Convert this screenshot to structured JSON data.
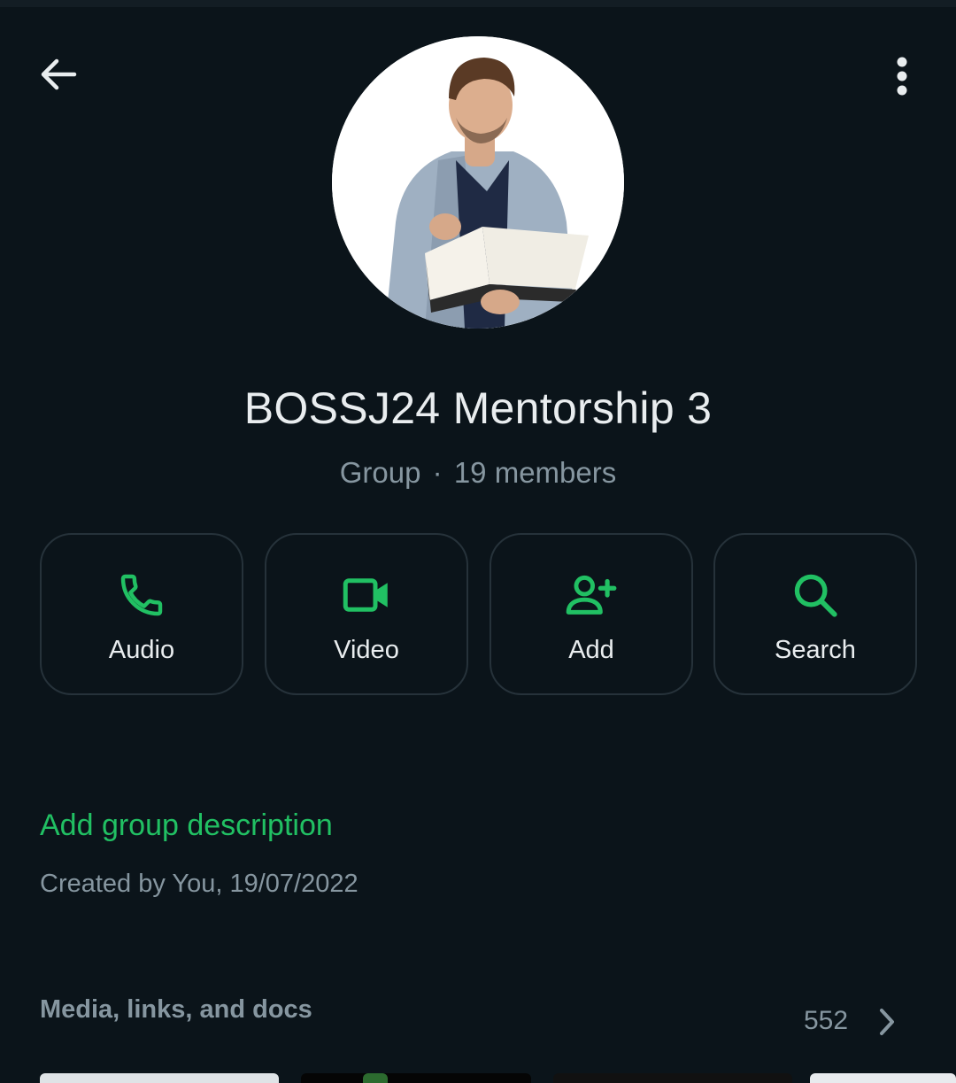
{
  "header": {
    "back_icon": "arrow-left-icon",
    "menu_icon": "more-vertical-icon"
  },
  "group": {
    "name": "BOSSJ24 Mentorship 3",
    "type": "Group",
    "separator": "·",
    "members": "19 members"
  },
  "actions": [
    {
      "label": "Audio",
      "icon": "phone-icon"
    },
    {
      "label": "Video",
      "icon": "video-camera-icon"
    },
    {
      "label": "Add",
      "icon": "add-person-icon"
    },
    {
      "label": "Search",
      "icon": "search-icon"
    }
  ],
  "description": {
    "add_label": "Add group description",
    "created": "Created by You, 19/07/2022"
  },
  "media": {
    "label": "Media, links, and docs",
    "count": "552",
    "icon": "chevron-right-icon"
  },
  "colors": {
    "background": "#0b141a",
    "accent": "#21c063",
    "primary_text": "#e9edef",
    "secondary_text": "#8696a0",
    "button_border": "#26323a"
  }
}
